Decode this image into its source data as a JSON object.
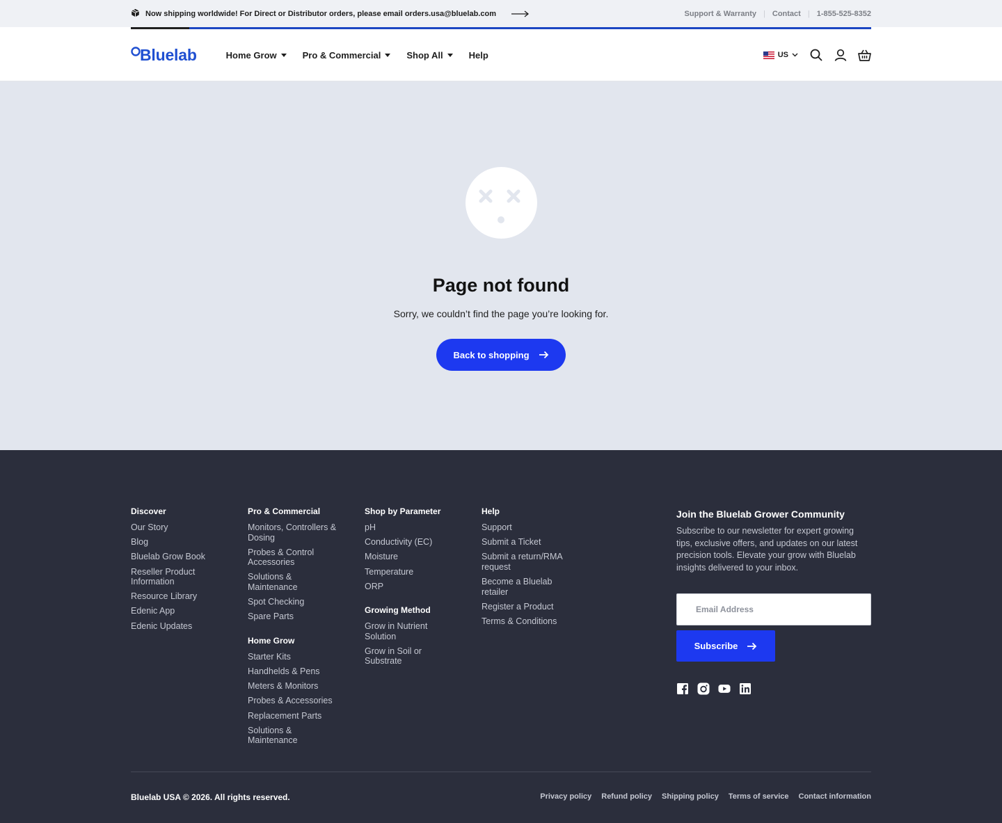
{
  "announcement": {
    "text": "Now shipping worldwide! For Direct or Distributor orders, please email orders.usa@bluelab.com",
    "links": [
      "Support & Warranty",
      "Contact",
      "1-855-525-8352"
    ]
  },
  "header": {
    "logo": "Bluelab",
    "nav": [
      "Home Grow",
      "Pro & Commercial",
      "Shop All",
      "Help"
    ],
    "locale": "US",
    "icons": [
      "search-icon",
      "account-icon",
      "cart-icon"
    ]
  },
  "not_found": {
    "title": "Page not found",
    "message": "Sorry, we couldn’t find the page you’re looking for.",
    "button": "Back to shopping"
  },
  "footer": {
    "discover": {
      "heading": "Discover",
      "links": [
        "Our Story",
        "Blog",
        "Bluelab Grow Book",
        "Reseller Product Information",
        "Resource Library",
        "Edenic App",
        "Edenic Updates"
      ]
    },
    "pro": {
      "heading": "Pro & Commercial",
      "links": [
        "Monitors, Controllers & Dosing",
        "Probes & Control Accessories",
        "Solutions & Maintenance",
        "Spot Checking",
        "Spare Parts"
      ]
    },
    "home_grow": {
      "heading": "Home Grow",
      "links": [
        "Starter Kits",
        "Handhelds & Pens",
        "Meters & Monitors",
        "Probes & Accessories",
        "Replacement Parts",
        "Solutions & Maintenance"
      ]
    },
    "parameter": {
      "heading": "Shop by Parameter",
      "links": [
        "pH",
        "Conductivity (EC)",
        "Moisture",
        "Temperature",
        "ORP"
      ]
    },
    "method": {
      "heading": "Growing Method",
      "links": [
        "Grow in Nutrient Solution",
        "Grow in Soil or Substrate"
      ]
    },
    "help": {
      "heading": "Help",
      "links": [
        "Support",
        "Submit a Ticket",
        "Submit a return/RMA request",
        "Become a Bluelab retailer",
        "Register a Product",
        "Terms & Conditions"
      ]
    },
    "newsletter": {
      "heading": "Join the Bluelab Grower Community",
      "text": "Subscribe to our newsletter for expert growing tips, exclusive offers, and updates on our latest precision tools. Elevate your grow with Bluelab insights delivered to your inbox.",
      "placeholder": "Email Address",
      "button": "Subscribe"
    },
    "social": [
      "facebook-icon",
      "instagram-icon",
      "youtube-icon",
      "linkedin-icon"
    ],
    "copyright": "Bluelab USA © 2026. All rights reserved.",
    "legal": [
      "Privacy policy",
      "Refund policy",
      "Shipping policy",
      "Terms of service",
      "Contact information"
    ]
  },
  "colors": {
    "brand_blue": "#1f4fd1",
    "button_blue": "#1d39f0",
    "footer_bg": "#2b2e3c",
    "main_bg": "#e2e6ee"
  }
}
